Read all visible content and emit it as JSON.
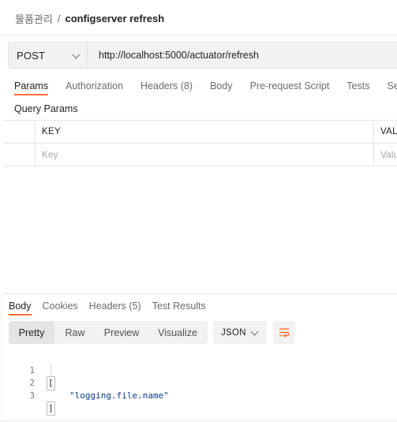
{
  "breadcrumb": {
    "parent": "물품관리",
    "separator": "/",
    "current": "configserver refresh"
  },
  "request": {
    "method": "POST",
    "url": "http://localhost:5000/actuator/refresh"
  },
  "request_tabs": [
    {
      "label": "Params",
      "count": ""
    },
    {
      "label": "Authorization",
      "count": ""
    },
    {
      "label": "Headers",
      "count": "(8)"
    },
    {
      "label": "Body",
      "count": ""
    },
    {
      "label": "Pre-request Script",
      "count": ""
    },
    {
      "label": "Tests",
      "count": ""
    },
    {
      "label": "Settings",
      "count": ""
    }
  ],
  "query_params": {
    "title": "Query Params",
    "header": {
      "key": "KEY",
      "value": "VALUE"
    },
    "placeholder": {
      "key": "Key",
      "value": "Value"
    }
  },
  "response_tabs": [
    {
      "label": "Body",
      "count": ""
    },
    {
      "label": "Cookies",
      "count": ""
    },
    {
      "label": "Headers",
      "count": "(5)"
    },
    {
      "label": "Test Results",
      "count": ""
    }
  ],
  "view_modes": [
    "Pretty",
    "Raw",
    "Preview",
    "Visualize"
  ],
  "format": "JSON",
  "code": {
    "lines": [
      "1",
      "2",
      "3"
    ],
    "open": "[",
    "value": "\"logging.file.name\"",
    "close": "]"
  },
  "icons": {
    "method_dropdown": "chevron-down-icon",
    "format_dropdown": "chevron-down-icon",
    "wrap": "wrap-lines-icon"
  },
  "colors": {
    "accent": "#ff6c37",
    "string": "#0b3a86",
    "muted": "#6b6b6b"
  }
}
